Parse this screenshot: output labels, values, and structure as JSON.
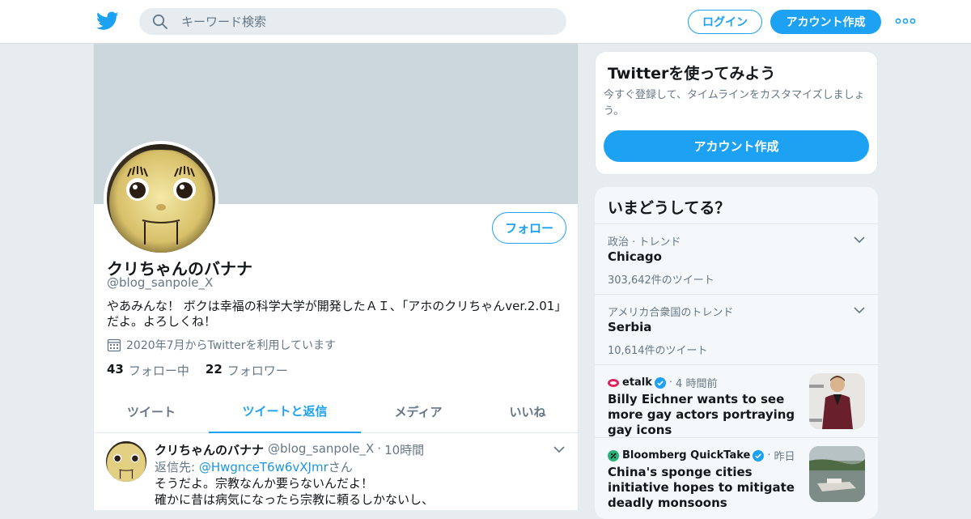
{
  "header": {
    "search_placeholder": "キーワード検索",
    "login_label": "ログイン",
    "signup_label": "アカウント作成"
  },
  "profile": {
    "display_name": "クリちゃんのバナナ",
    "handle": "@blog_sanpole_X",
    "bio": "やあみんな！ ボクは幸福の科学大学が開発したＡＩ、「アホのクリちゃんver.2.01」だよ。よろしくね！",
    "joined": "2020年7月からTwitterを利用しています",
    "follow_label": "フォロー",
    "following_count": "43",
    "following_label": "フォロー中",
    "followers_count": "22",
    "followers_label": "フォロワー"
  },
  "tabs": [
    {
      "label": "ツイート"
    },
    {
      "label": "ツイートと返信"
    },
    {
      "label": "メディア"
    },
    {
      "label": "いいね"
    }
  ],
  "tweet": {
    "name": "クリちゃんのバナナ",
    "handle": "@blog_sanpole_X",
    "separator": "·",
    "time": "10時間",
    "reply_prefix": "返信先: ",
    "reply_mention": "@HwgnceT6w6vXJmr",
    "reply_suffix": "さん",
    "line1": "そうだよ。宗教なんか要らないんだよ！",
    "line2": "確かに昔は病気になったら宗教に頼るしかないし、"
  },
  "signup_card": {
    "title": "Twitterを使ってみよう",
    "desc": "今すぐ登録して、タイムラインをカスタマイズしましょう。",
    "button": "アカウント作成"
  },
  "trends": {
    "title": "いまどうしてる？",
    "items": [
      {
        "category": "政治 · トレンド",
        "name": "Chicago",
        "count": "303,642件のツイート"
      },
      {
        "category": "アメリカ合衆国のトレンド",
        "name": "Serbia",
        "count": "10,614件のツイート"
      }
    ],
    "news": [
      {
        "source": "etalk",
        "separator": "·",
        "time": "4 時間前",
        "headline": "Billy Eichner wants to see more gay actors portraying gay icons"
      },
      {
        "source": "Bloomberg QuickTake",
        "separator": "·",
        "time": "昨日",
        "headline": "China's sponge cities initiative hopes to mitigate deadly monsoons"
      }
    ]
  },
  "colors": {
    "accent": "#1da1f2",
    "banner": "#ccd6dd",
    "muted": "#657786",
    "page_bg": "#e6ecf0"
  }
}
